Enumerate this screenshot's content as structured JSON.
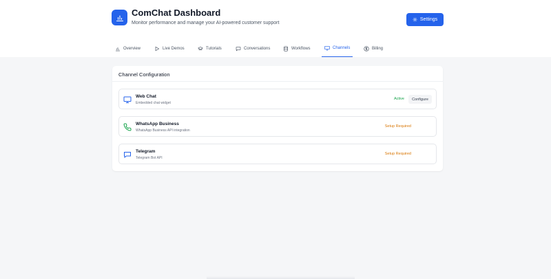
{
  "header": {
    "title": "ComChat Dashboard",
    "subtitle": "Monitor performance and manage your AI-powered customer support",
    "logo_icon": "bar-chart-icon",
    "settings_label": "Settings",
    "settings_icon": "gear-icon"
  },
  "nav": {
    "tabs": [
      {
        "label": "Overview",
        "icon": "bar-chart-icon",
        "active": false
      },
      {
        "label": "Live Demos",
        "icon": "play-icon",
        "active": false
      },
      {
        "label": "Tutorials",
        "icon": "graduation-cap-icon",
        "active": false
      },
      {
        "label": "Conversations",
        "icon": "chat-bubble-icon",
        "active": false
      },
      {
        "label": "Workflows",
        "icon": "database-icon",
        "active": false
      },
      {
        "label": "Channels",
        "icon": "monitor-icon",
        "active": true
      },
      {
        "label": "Billing",
        "icon": "dollar-icon",
        "active": false
      }
    ]
  },
  "channel_config": {
    "title": "Channel Configuration",
    "channels": [
      {
        "name": "Web Chat",
        "description": "Embedded chat widget",
        "status": "Active",
        "action": "Configure",
        "icon": "monitor-icon"
      },
      {
        "name": "WhatsApp Business",
        "description": "WhatsApp Business API integration",
        "status": "Setup Required",
        "icon": "phone-icon"
      },
      {
        "name": "Telegram",
        "description": "Telegram Bot API",
        "status": "Setup Required",
        "icon": "chat-bubble-icon"
      }
    ]
  },
  "colors": {
    "accent": "#2563eb",
    "active": "#16a34a",
    "setup": "#d97706"
  }
}
